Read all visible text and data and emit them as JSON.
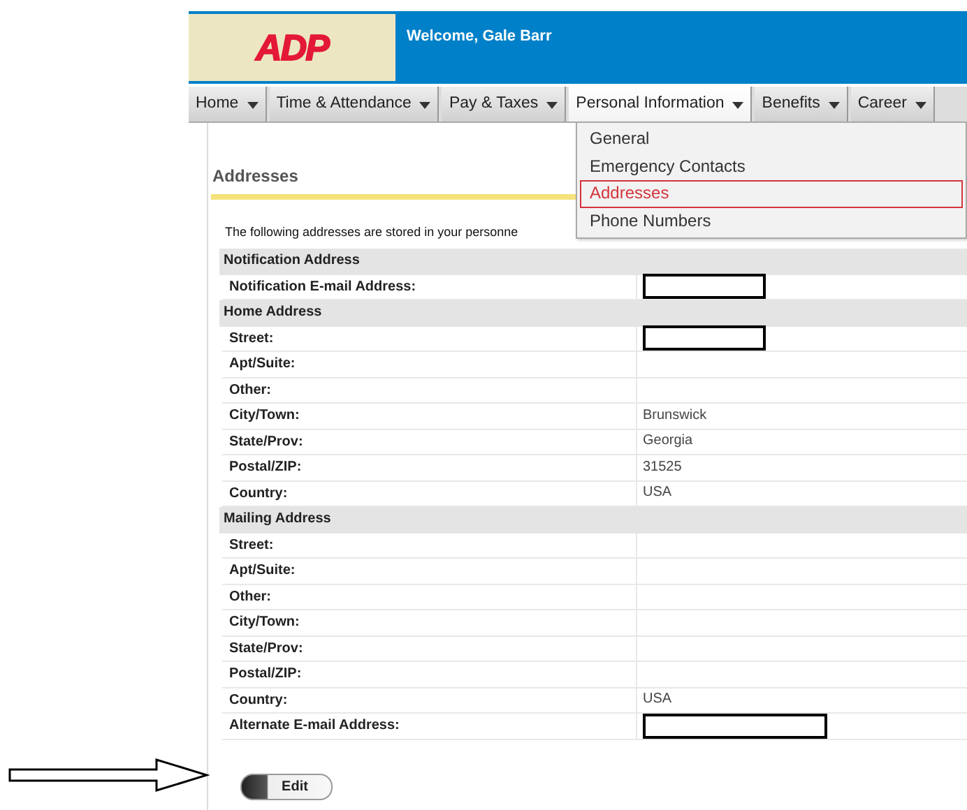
{
  "header": {
    "logo": "ADP",
    "welcome": "Welcome, Gale Barr"
  },
  "nav": [
    {
      "label": "Home",
      "selected": false
    },
    {
      "label": "Time & Attendance",
      "selected": false
    },
    {
      "label": "Pay & Taxes",
      "selected": false
    },
    {
      "label": "Personal Information",
      "selected": true
    },
    {
      "label": "Benefits",
      "selected": false
    },
    {
      "label": "Career",
      "selected": false
    }
  ],
  "dropdown": [
    {
      "label": "General",
      "selected": false
    },
    {
      "label": "Emergency Contacts",
      "selected": false
    },
    {
      "label": "Addresses",
      "selected": true
    },
    {
      "label": "Phone Numbers",
      "selected": false
    }
  ],
  "page_title": "Addresses",
  "intro": "The following addresses are stored in your personne",
  "sections": [
    {
      "title": "Notification Address",
      "rows": [
        {
          "label": "Notification E-mail Address:",
          "redacted": true
        }
      ]
    },
    {
      "title": "Home Address",
      "rows": [
        {
          "label": "Street:",
          "redacted": true
        },
        {
          "label": "Apt/Suite:"
        },
        {
          "label": "Other:"
        },
        {
          "label": "City/Town:",
          "value": "Brunswick"
        },
        {
          "label": "State/Prov:",
          "value": "Georgia"
        },
        {
          "label": "Postal/ZIP:",
          "value": "31525"
        },
        {
          "label": "Country:",
          "value": "USA"
        }
      ]
    },
    {
      "title": "Mailing Address",
      "rows": [
        {
          "label": "Street:"
        },
        {
          "label": "Apt/Suite:"
        },
        {
          "label": "Other:"
        },
        {
          "label": "City/Town:"
        },
        {
          "label": "State/Prov:"
        },
        {
          "label": "Postal/ZIP:"
        },
        {
          "label": "Country:",
          "value": "USA"
        },
        {
          "label": "Alternate E-mail Address:",
          "redacted": true,
          "wide": true
        }
      ]
    }
  ],
  "edit_button": "Edit"
}
